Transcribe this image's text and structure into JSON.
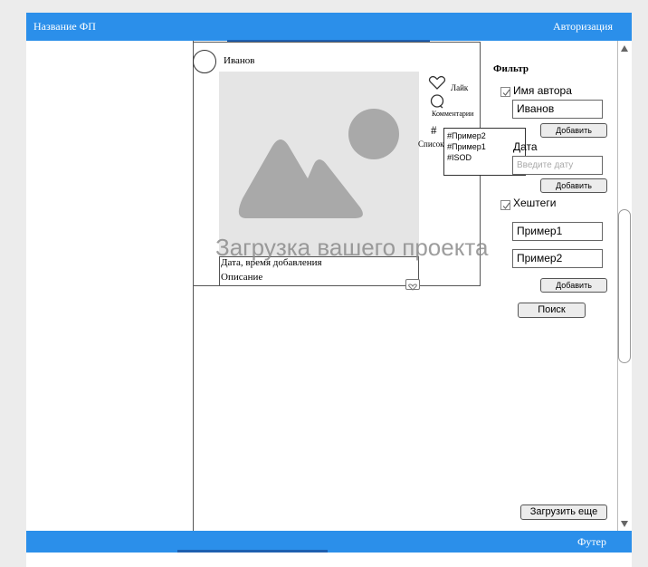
{
  "header": {
    "title": "Название ФП",
    "auth_link": "Авторизация"
  },
  "footer": {
    "label": "Футер"
  },
  "post": {
    "author": "Иванов",
    "date_label": "Дата, время добавления",
    "description": "Описание",
    "like_label": "Лайк",
    "comments_label": "Комментарии",
    "list_label": "Список",
    "hashtags": [
      "#Пример2",
      "#Пример1",
      "#ISOD"
    ]
  },
  "watermark": "Загрузка вашего проекта",
  "filter": {
    "title": "Фильтр",
    "author_label": "Имя автора",
    "author_value": "Иванов",
    "add_label": "Добавить",
    "date_label": "Дата",
    "date_placeholder": "Введите дату",
    "hashtags_label": "Хештеги",
    "tag1_value": "Пример1",
    "tag2_value": "Пример2",
    "search_label": "Поиск"
  },
  "load_more_label": "Загрузить еще"
}
